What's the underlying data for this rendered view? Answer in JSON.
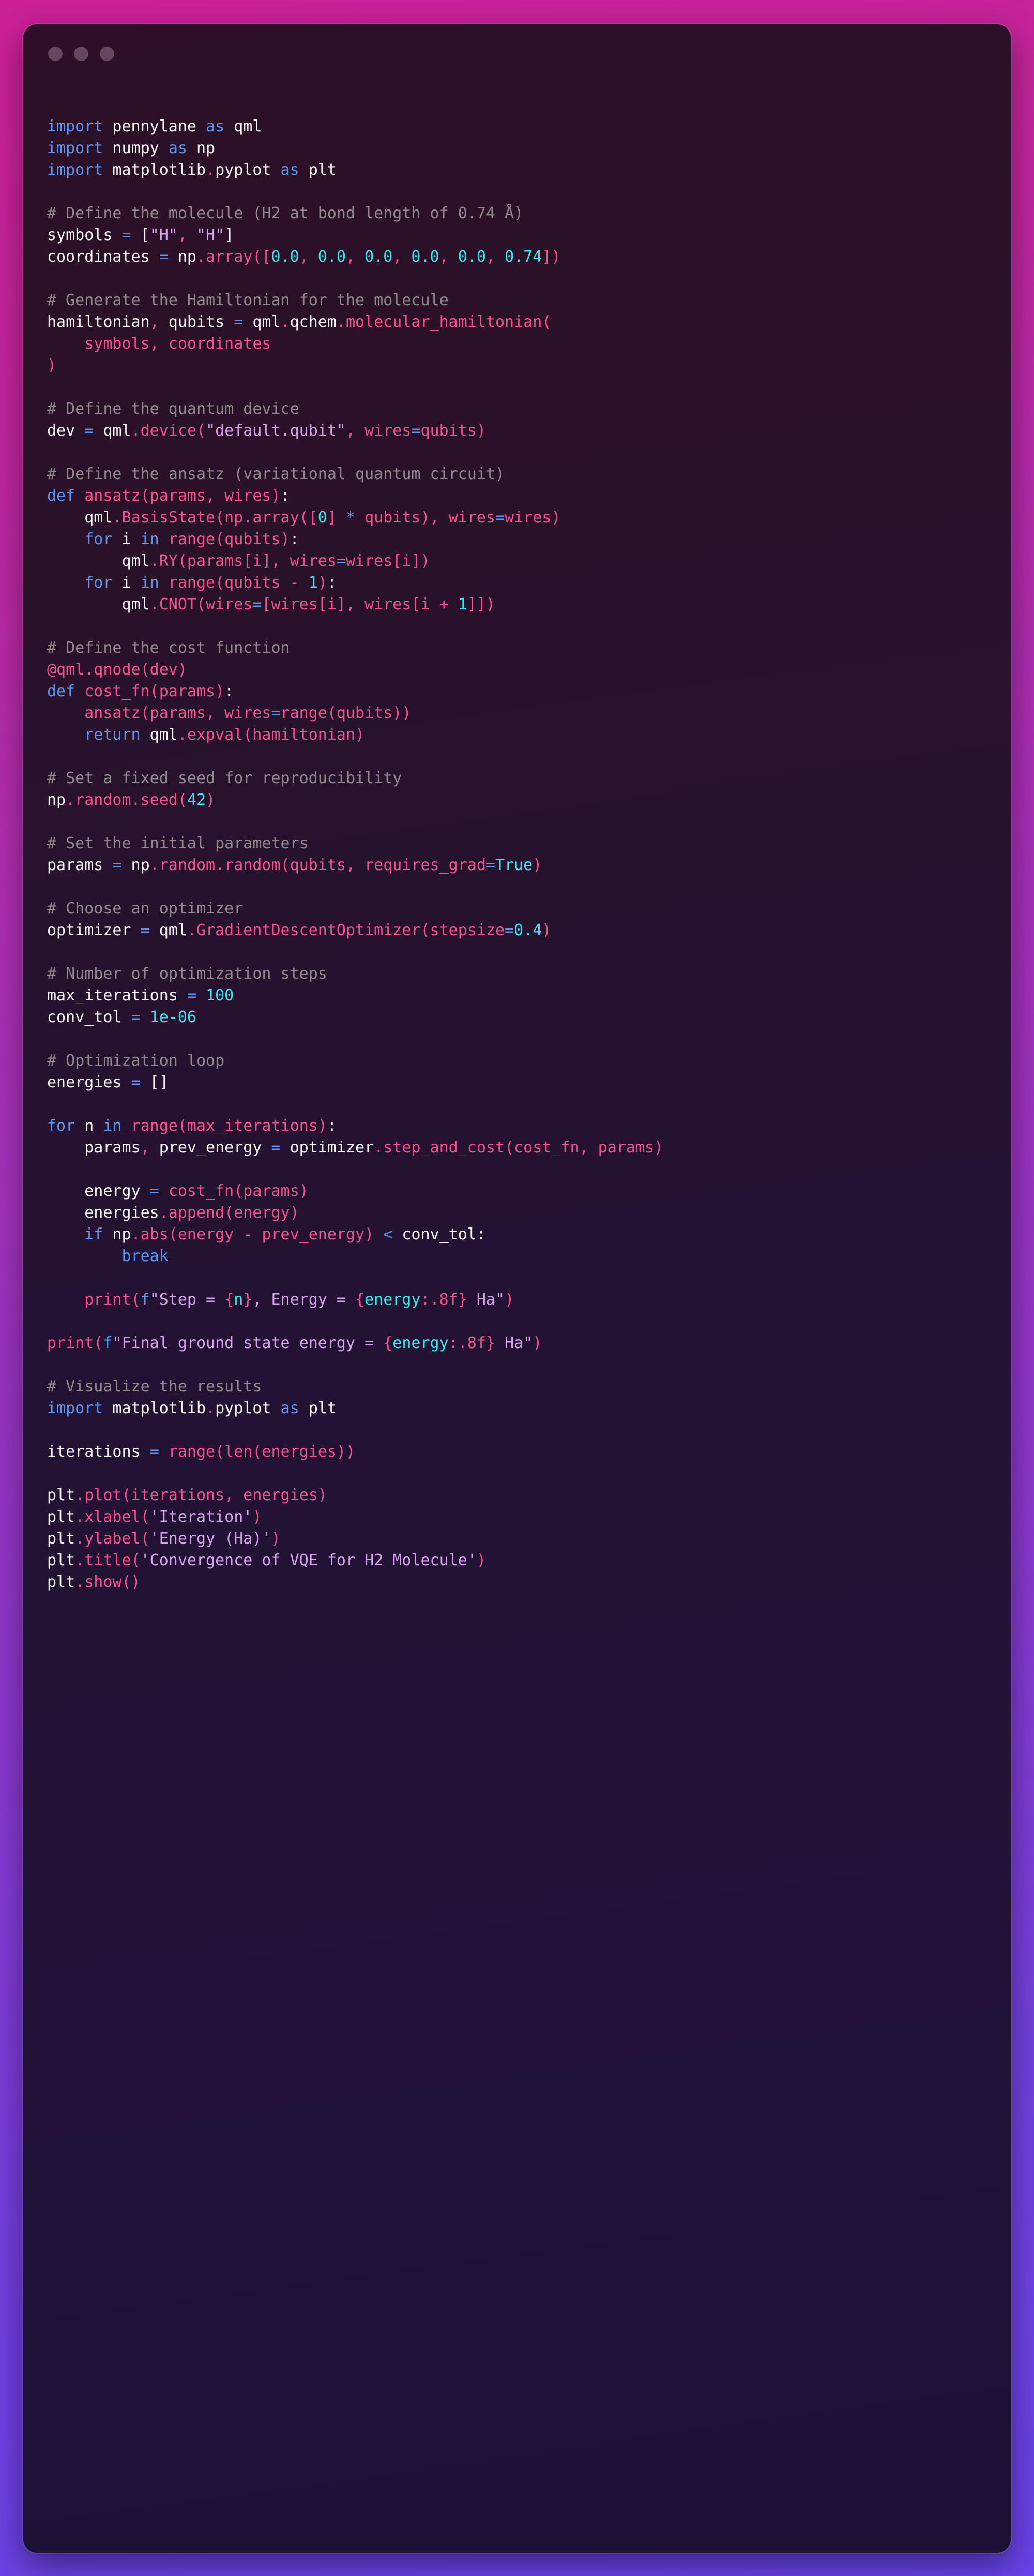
{
  "window": {
    "traffic_lights": [
      "close-dot",
      "minimize-dot",
      "maximize-dot"
    ],
    "background_gradient": {
      "from": "#CB2096",
      "to": "#6643E8"
    },
    "surface_gradient": {
      "from": "#2D1027",
      "to": "#1C1037"
    }
  },
  "theme": {
    "keyword": "#5C95F2",
    "function": "#F3528C",
    "string": "#D8A4F0",
    "number": "#3AE7F0",
    "comment": "#938A90",
    "plain": "#FAFAFA"
  },
  "code": {
    "language": "python",
    "lines": [
      [
        [
          "k",
          "import"
        ],
        [
          "p",
          " pennylane "
        ],
        [
          "k",
          "as"
        ],
        [
          "p",
          " qml"
        ]
      ],
      [
        [
          "k",
          "import"
        ],
        [
          "p",
          " numpy "
        ],
        [
          "k",
          "as"
        ],
        [
          "p",
          " np"
        ]
      ],
      [
        [
          "k",
          "import"
        ],
        [
          "p",
          " matplotlib"
        ],
        [
          "f",
          "."
        ],
        [
          "p",
          "pyplot "
        ],
        [
          "k",
          "as"
        ],
        [
          "p",
          " plt"
        ]
      ],
      [],
      [
        [
          "c",
          "# Define the molecule (H2 at bond length of 0.74 Å)"
        ]
      ],
      [
        [
          "p",
          "symbols "
        ],
        [
          "op",
          "="
        ],
        [
          "p",
          " ["
        ],
        [
          "s",
          "\"H\""
        ],
        [
          "f",
          ","
        ],
        [
          "p",
          " "
        ],
        [
          "s",
          "\"H\""
        ],
        [
          "p",
          "]"
        ]
      ],
      [
        [
          "p",
          "coordinates "
        ],
        [
          "op",
          "="
        ],
        [
          "p",
          " np"
        ],
        [
          "f",
          "."
        ],
        [
          "f",
          "array"
        ],
        [
          "f",
          "(["
        ],
        [
          "n",
          "0.0"
        ],
        [
          "f",
          ","
        ],
        [
          "n",
          " 0.0"
        ],
        [
          "f",
          ","
        ],
        [
          "n",
          " 0.0"
        ],
        [
          "f",
          ","
        ],
        [
          "n",
          " 0.0"
        ],
        [
          "f",
          ","
        ],
        [
          "n",
          " 0.0"
        ],
        [
          "f",
          ","
        ],
        [
          "n",
          " 0.74"
        ],
        [
          "f",
          "])"
        ]
      ],
      [],
      [
        [
          "c",
          "# Generate the Hamiltonian for the molecule"
        ]
      ],
      [
        [
          "p",
          "hamiltonian"
        ],
        [
          "f",
          ","
        ],
        [
          "p",
          " qubits "
        ],
        [
          "op",
          "="
        ],
        [
          "p",
          " qml"
        ],
        [
          "f",
          "."
        ],
        [
          "p",
          "qchem"
        ],
        [
          "f",
          ".molecular_hamiltonian("
        ]
      ],
      [
        [
          "f",
          "    symbols, coordinates"
        ]
      ],
      [
        [
          "f",
          ")"
        ]
      ],
      [],
      [
        [
          "c",
          "# Define the quantum device"
        ]
      ],
      [
        [
          "p",
          "dev "
        ],
        [
          "op",
          "="
        ],
        [
          "p",
          " qml"
        ],
        [
          "f",
          ".device("
        ],
        [
          "s",
          "\"default.qubit\""
        ],
        [
          "f",
          ", wires"
        ],
        [
          "op",
          "="
        ],
        [
          "f",
          "qubits)"
        ]
      ],
      [],
      [
        [
          "c",
          "# Define the ansatz (variational quantum circuit)"
        ]
      ],
      [
        [
          "k",
          "def"
        ],
        [
          "f",
          " ansatz(params, wires)"
        ],
        [
          "p",
          ":"
        ]
      ],
      [
        [
          "p",
          "    qml"
        ],
        [
          "f",
          ".BasisState(np.array(["
        ],
        [
          "n",
          "0"
        ],
        [
          "f",
          "] "
        ],
        [
          "op",
          "*"
        ],
        [
          "f",
          " qubits), wires"
        ],
        [
          "op",
          "="
        ],
        [
          "f",
          "wires)"
        ]
      ],
      [
        [
          "k",
          "    for"
        ],
        [
          "p",
          " i "
        ],
        [
          "k",
          "in"
        ],
        [
          "f",
          " range(qubits)"
        ],
        [
          "p",
          ":"
        ]
      ],
      [
        [
          "p",
          "        qml"
        ],
        [
          "f",
          ".RY(params[i], wires"
        ],
        [
          "op",
          "="
        ],
        [
          "f",
          "wires[i])"
        ]
      ],
      [
        [
          "k",
          "    for"
        ],
        [
          "p",
          " i "
        ],
        [
          "k",
          "in"
        ],
        [
          "f",
          " range(qubits "
        ],
        [
          "f",
          "- "
        ],
        [
          "n",
          "1"
        ],
        [
          "f",
          ")"
        ],
        [
          "p",
          ":"
        ]
      ],
      [
        [
          "p",
          "        qml"
        ],
        [
          "f",
          ".CNOT(wires"
        ],
        [
          "op",
          "="
        ],
        [
          "f",
          "[wires[i], wires[i "
        ],
        [
          "f",
          "+ "
        ],
        [
          "n",
          "1"
        ],
        [
          "f",
          "]])"
        ]
      ],
      [],
      [
        [
          "c",
          "# Define the cost function"
        ]
      ],
      [
        [
          "f",
          "@qml.qnode(dev)"
        ]
      ],
      [
        [
          "k",
          "def"
        ],
        [
          "f",
          " cost_fn(params)"
        ],
        [
          "p",
          ":"
        ]
      ],
      [
        [
          "f",
          "    ansatz(params, wires"
        ],
        [
          "op",
          "="
        ],
        [
          "f",
          "range(qubits))"
        ]
      ],
      [
        [
          "k",
          "    return"
        ],
        [
          "p",
          " qml"
        ],
        [
          "f",
          ".expval(hamiltonian)"
        ]
      ],
      [],
      [
        [
          "c",
          "# Set a fixed seed for reproducibility"
        ]
      ],
      [
        [
          "p",
          "np"
        ],
        [
          "f",
          ".random."
        ],
        [
          "f",
          "seed("
        ],
        [
          "n",
          "42"
        ],
        [
          "f",
          ")"
        ]
      ],
      [],
      [
        [
          "c",
          "# Set the initial parameters"
        ]
      ],
      [
        [
          "p",
          "params "
        ],
        [
          "op",
          "="
        ],
        [
          "p",
          " np"
        ],
        [
          "f",
          ".random."
        ],
        [
          "f",
          "random(qubits, requires_grad"
        ],
        [
          "op",
          "="
        ],
        [
          "n",
          "True"
        ],
        [
          "f",
          ")"
        ]
      ],
      [],
      [
        [
          "c",
          "# Choose an optimizer"
        ]
      ],
      [
        [
          "p",
          "optimizer "
        ],
        [
          "op",
          "="
        ],
        [
          "p",
          " qml"
        ],
        [
          "f",
          ".GradientDescentOptimizer(stepsize"
        ],
        [
          "op",
          "="
        ],
        [
          "n",
          "0.4"
        ],
        [
          "f",
          ")"
        ]
      ],
      [],
      [
        [
          "c",
          "# Number of optimization steps"
        ]
      ],
      [
        [
          "p",
          "max_iterations "
        ],
        [
          "op",
          "="
        ],
        [
          "p",
          " "
        ],
        [
          "n",
          "100"
        ]
      ],
      [
        [
          "p",
          "conv_tol "
        ],
        [
          "op",
          "="
        ],
        [
          "p",
          " "
        ],
        [
          "n",
          "1e-06"
        ]
      ],
      [],
      [
        [
          "c",
          "# Optimization loop"
        ]
      ],
      [
        [
          "p",
          "energies "
        ],
        [
          "op",
          "="
        ],
        [
          "p",
          " []"
        ]
      ],
      [],
      [
        [
          "k",
          "for"
        ],
        [
          "p",
          " n "
        ],
        [
          "k",
          "in"
        ],
        [
          "f",
          " range(max_iterations)"
        ],
        [
          "p",
          ":"
        ]
      ],
      [
        [
          "p",
          "    params"
        ],
        [
          "f",
          ","
        ],
        [
          "p",
          " prev_energy "
        ],
        [
          "op",
          "="
        ],
        [
          "p",
          " optimizer"
        ],
        [
          "f",
          ".step_and_cost(cost_fn, params)"
        ]
      ],
      [],
      [
        [
          "p",
          "    energy "
        ],
        [
          "op",
          "="
        ],
        [
          "p",
          " "
        ],
        [
          "f",
          "cost_fn(params)"
        ]
      ],
      [
        [
          "p",
          "    energies"
        ],
        [
          "f",
          ".append(energy)"
        ]
      ],
      [
        [
          "k",
          "    if"
        ],
        [
          "p",
          " np"
        ],
        [
          "f",
          ".abs(energy "
        ],
        [
          "f",
          "- "
        ],
        [
          "f",
          "prev_energy) "
        ],
        [
          "op",
          "<"
        ],
        [
          "p",
          " conv_tol"
        ],
        [
          "p",
          ":"
        ]
      ],
      [
        [
          "k",
          "        break"
        ]
      ],
      [],
      [
        [
          "f",
          "    print("
        ],
        [
          "k",
          "f"
        ],
        [
          "s",
          "\"Step = "
        ],
        [
          "f",
          "{"
        ],
        [
          "n",
          "n"
        ],
        [
          "f",
          "}"
        ],
        [
          "s",
          ", Energy = "
        ],
        [
          "f",
          "{"
        ],
        [
          "n",
          "energy"
        ],
        [
          "f",
          ":.8f}"
        ],
        [
          "s",
          " Ha\""
        ],
        [
          "f",
          ")"
        ]
      ],
      [],
      [
        [
          "f",
          "print("
        ],
        [
          "k",
          "f"
        ],
        [
          "s",
          "\"Final ground state energy = "
        ],
        [
          "f",
          "{"
        ],
        [
          "n",
          "energy"
        ],
        [
          "f",
          ":.8f}"
        ],
        [
          "s",
          " Ha\""
        ],
        [
          "f",
          ")"
        ]
      ],
      [],
      [
        [
          "c",
          "# Visualize the results"
        ]
      ],
      [
        [
          "k",
          "import"
        ],
        [
          "p",
          " matplotlib"
        ],
        [
          "f",
          "."
        ],
        [
          "p",
          "pyplot "
        ],
        [
          "k",
          "as"
        ],
        [
          "p",
          " plt"
        ]
      ],
      [],
      [
        [
          "p",
          "iterations "
        ],
        [
          "op",
          "="
        ],
        [
          "p",
          " "
        ],
        [
          "f",
          "range(len(energies))"
        ]
      ],
      [],
      [
        [
          "p",
          "plt"
        ],
        [
          "f",
          ".plot(iterations, energies)"
        ]
      ],
      [
        [
          "p",
          "plt"
        ],
        [
          "f",
          ".xlabel("
        ],
        [
          "s",
          "'Iteration'"
        ],
        [
          "f",
          ")"
        ]
      ],
      [
        [
          "p",
          "plt"
        ],
        [
          "f",
          ".ylabel("
        ],
        [
          "s",
          "'Energy (Ha)'"
        ],
        [
          "f",
          ")"
        ]
      ],
      [
        [
          "p",
          "plt"
        ],
        [
          "f",
          ".title("
        ],
        [
          "s",
          "'Convergence of VQE for H2 Molecule'"
        ],
        [
          "f",
          ")"
        ]
      ],
      [
        [
          "p",
          "plt"
        ],
        [
          "f",
          ".show()"
        ]
      ]
    ],
    "plain_text": [
      "import pennylane as qml",
      "import numpy as np",
      "import matplotlib.pyplot as plt",
      "",
      "# Define the molecule (H2 at bond length of 0.74 Å)",
      "symbols = [\"H\", \"H\"]",
      "coordinates = np.array([0.0, 0.0, 0.0, 0.0, 0.0, 0.74])",
      "",
      "# Generate the Hamiltonian for the molecule",
      "hamiltonian, qubits = qml.qchem.molecular_hamiltonian(",
      "    symbols, coordinates",
      ")",
      "",
      "# Define the quantum device",
      "dev = qml.device(\"default.qubit\", wires=qubits)",
      "",
      "# Define the ansatz (variational quantum circuit)",
      "def ansatz(params, wires):",
      "    qml.BasisState(np.array([0] * qubits), wires=wires)",
      "    for i in range(qubits):",
      "        qml.RY(params[i], wires=wires[i])",
      "    for i in range(qubits - 1):",
      "        qml.CNOT(wires=[wires[i], wires[i + 1]])",
      "",
      "# Define the cost function",
      "@qml.qnode(dev)",
      "def cost_fn(params):",
      "    ansatz(params, wires=range(qubits))",
      "    return qml.expval(hamiltonian)",
      "",
      "# Set a fixed seed for reproducibility",
      "np.random.seed(42)",
      "",
      "# Set the initial parameters",
      "params = np.random.random(qubits, requires_grad=True)",
      "",
      "# Choose an optimizer",
      "optimizer = qml.GradientDescentOptimizer(stepsize=0.4)",
      "",
      "# Number of optimization steps",
      "max_iterations = 100",
      "conv_tol = 1e-06",
      "",
      "# Optimization loop",
      "energies = []",
      "",
      "for n in range(max_iterations):",
      "    params, prev_energy = optimizer.step_and_cost(cost_fn, params)",
      "",
      "    energy = cost_fn(params)",
      "    energies.append(energy)",
      "    if np.abs(energy - prev_energy) < conv_tol:",
      "        break",
      "",
      "    print(f\"Step = {n}, Energy = {energy:.8f} Ha\")",
      "",
      "print(f\"Final ground state energy = {energy:.8f} Ha\")",
      "",
      "# Visualize the results",
      "import matplotlib.pyplot as plt",
      "",
      "iterations = range(len(energies))",
      "",
      "plt.plot(iterations, energies)",
      "plt.xlabel('Iteration')",
      "plt.ylabel('Energy (Ha)')",
      "plt.title('Convergence of VQE for H2 Molecule')",
      "plt.show()"
    ]
  }
}
